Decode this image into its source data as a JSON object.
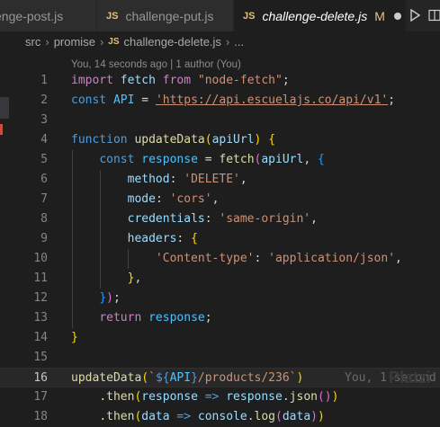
{
  "tabs": [
    {
      "label": "ge-post.js",
      "prefix": "en",
      "icon": "js-file-icon",
      "active": false
    },
    {
      "label": "challenge-put.js",
      "icon": "js-file-icon",
      "active": false
    },
    {
      "label": "challenge-delete.js",
      "icon": "js-file-icon",
      "active": true,
      "badge": "M"
    }
  ],
  "tab_icon_text": "JS",
  "breadcrumb": {
    "items": [
      "src",
      "promise",
      "challenge-delete.js",
      "..."
    ],
    "separator": "›"
  },
  "blame_header": "You, 14 seconds ago | 1 author (You)",
  "inline_blame": "You, 1 second",
  "line_numbers": [
    "1",
    "2",
    "3",
    "4",
    "5",
    "6",
    "7",
    "8",
    "9",
    "10",
    "11",
    "12",
    "13",
    "14",
    "15",
    "16",
    "17",
    "18"
  ],
  "current_line": 16,
  "code": {
    "l1": {
      "import": "import",
      "name": "fetch",
      "from": "from",
      "module": "\"node-fetch\"",
      "end": ";"
    },
    "l2": {
      "const": "const",
      "name": "API",
      "eq": " = ",
      "url": "'https://api.escuelajs.co/api/v1'",
      "end": ";"
    },
    "l4": {
      "function": "function",
      "name": "updateData",
      "param": "apiUrl"
    },
    "l5": {
      "const": "const",
      "name": "response",
      "eq": " = ",
      "call": "fetch",
      "arg": "apiUrl"
    },
    "l6": {
      "key": "method",
      "value": "'DELETE'"
    },
    "l7": {
      "key": "mode",
      "value": "'cors'"
    },
    "l8": {
      "key": "credentials",
      "value": "'same-origin'"
    },
    "l9": {
      "key": "headers"
    },
    "l10": {
      "key": "'Content-type'",
      "value": "'application/json'"
    },
    "l13": {
      "return": "return",
      "name": "response"
    },
    "l16": {
      "call": "updateData",
      "tpl_start": "`",
      "interp_open": "${",
      "api": "API",
      "interp_close": "}",
      "path": "/products/236",
      "tpl_end": "`"
    },
    "l17": {
      "then": ".then",
      "p": "response",
      "arrow": "=>",
      "obj": "response",
      "method": "json"
    },
    "l18": {
      "then": ".then",
      "p": "data",
      "arrow": "=>",
      "obj": "console",
      "method": "log",
      "arg": "data"
    }
  },
  "watermark": "Platzi",
  "colors": {
    "editor_bg": "#1e1e1e",
    "keyword": "#c586c0",
    "string": "#ce9178",
    "function": "#dcdcaa",
    "variable": "#9cdcfe"
  }
}
